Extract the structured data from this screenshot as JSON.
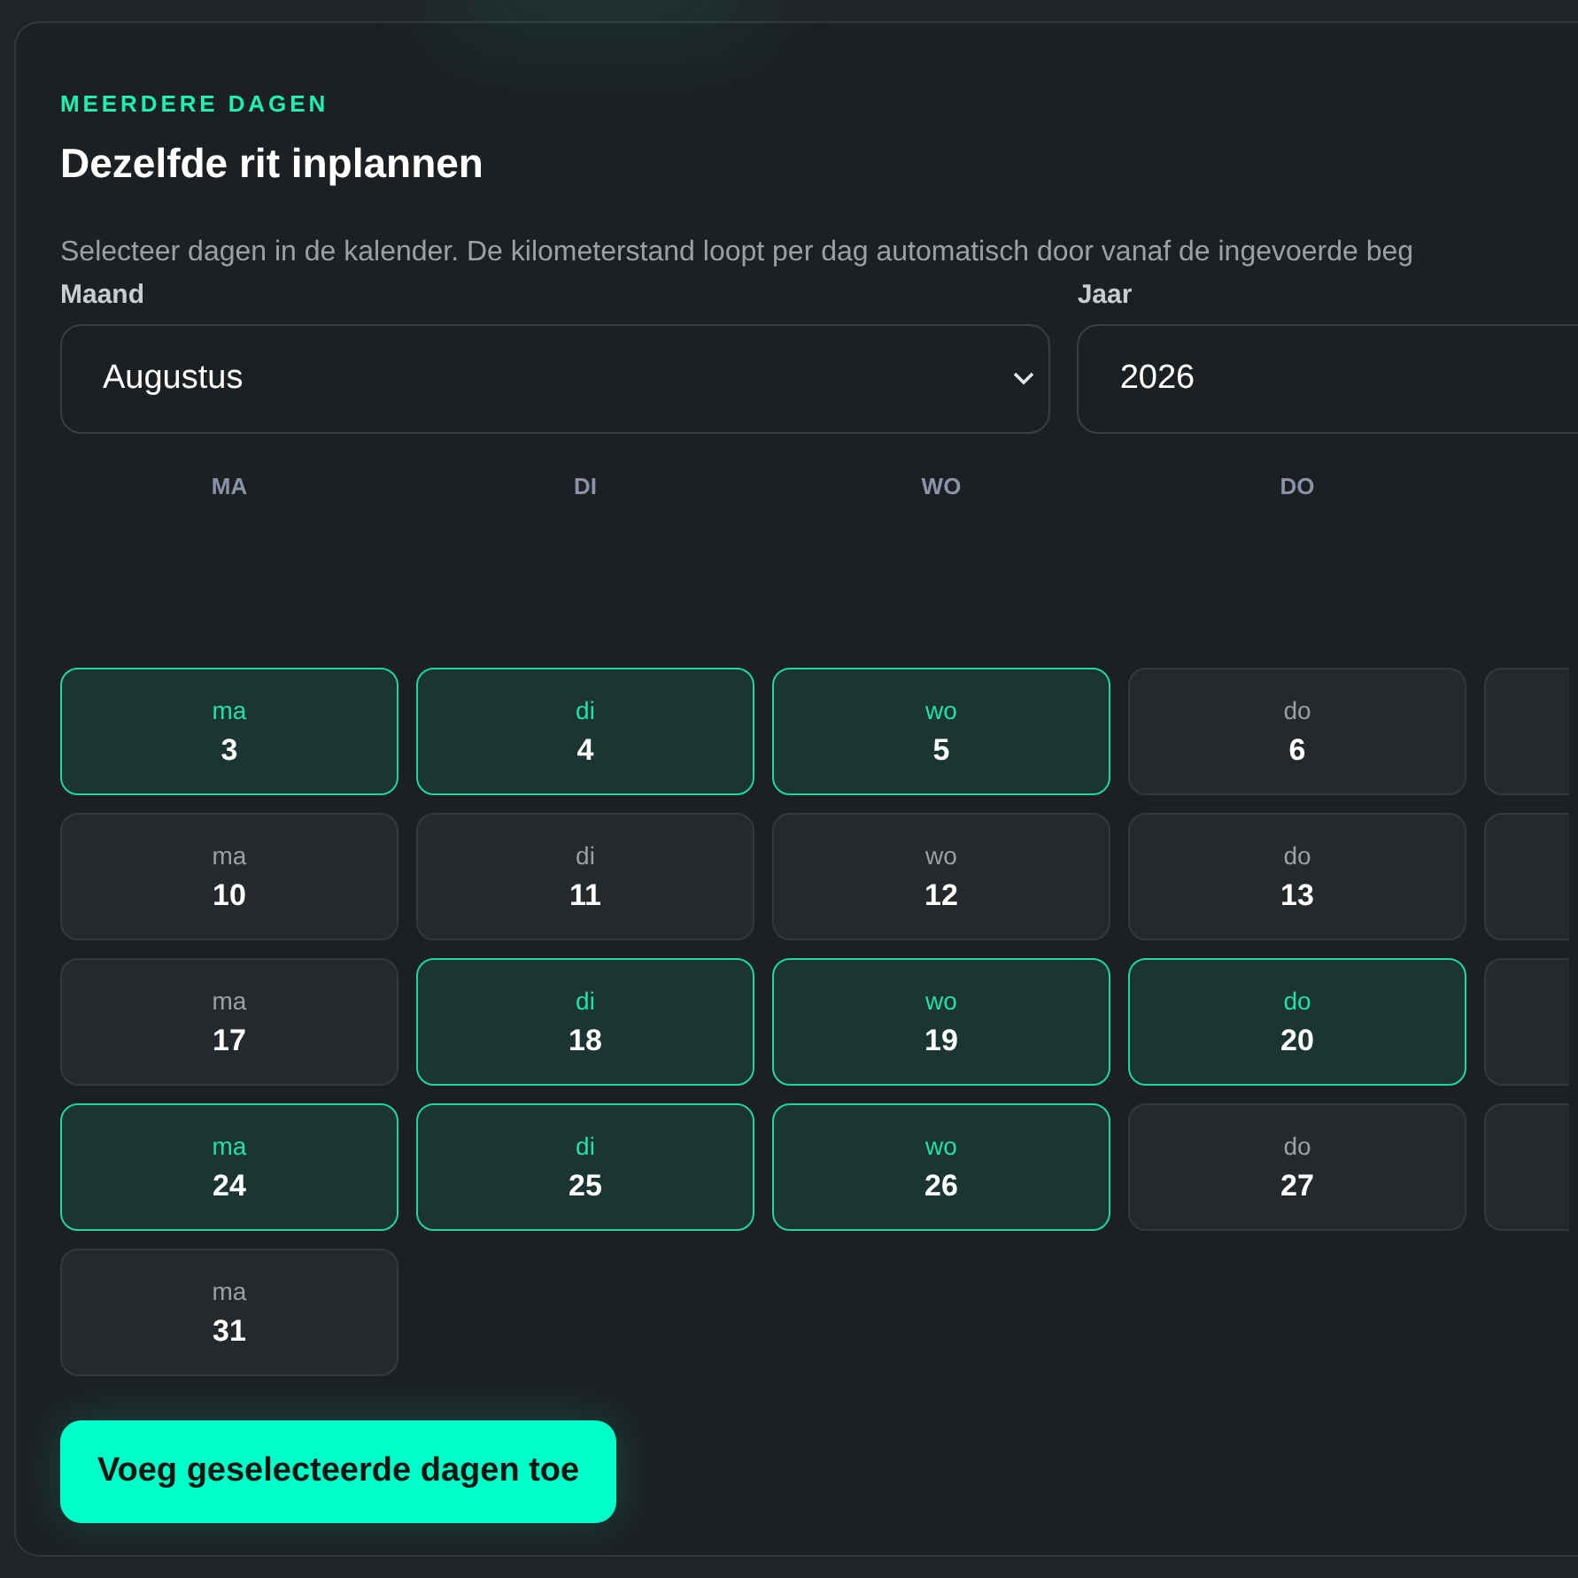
{
  "section_label": "MEERDERE DAGEN",
  "title": "Dezelfde rit inplannen",
  "description": "Selecteer dagen in de kalender. De kilometerstand loopt per dag automatisch door vanaf de ingevoerde beg",
  "month": {
    "label": "Maand",
    "value": "Augustus"
  },
  "year": {
    "label": "Jaar",
    "value": "2026"
  },
  "weekday_headers": [
    "MA",
    "DI",
    "WO",
    "DO"
  ],
  "weeks": [
    [
      {
        "kind": "blank"
      },
      {
        "kind": "blank"
      },
      {
        "kind": "blank"
      },
      {
        "kind": "blank"
      },
      {
        "kind": "blank"
      }
    ],
    [
      {
        "kind": "day",
        "weekday": "ma",
        "day": "3",
        "selected": true
      },
      {
        "kind": "day",
        "weekday": "di",
        "day": "4",
        "selected": true
      },
      {
        "kind": "day",
        "weekday": "wo",
        "day": "5",
        "selected": true
      },
      {
        "kind": "day",
        "weekday": "do",
        "day": "6",
        "selected": false
      },
      {
        "kind": "clipped",
        "selected": false
      }
    ],
    [
      {
        "kind": "day",
        "weekday": "ma",
        "day": "10",
        "selected": false
      },
      {
        "kind": "day",
        "weekday": "di",
        "day": "11",
        "selected": false
      },
      {
        "kind": "day",
        "weekday": "wo",
        "day": "12",
        "selected": false
      },
      {
        "kind": "day",
        "weekday": "do",
        "day": "13",
        "selected": false
      },
      {
        "kind": "clipped",
        "selected": false
      }
    ],
    [
      {
        "kind": "day",
        "weekday": "ma",
        "day": "17",
        "selected": false
      },
      {
        "kind": "day",
        "weekday": "di",
        "day": "18",
        "selected": true
      },
      {
        "kind": "day",
        "weekday": "wo",
        "day": "19",
        "selected": true
      },
      {
        "kind": "day",
        "weekday": "do",
        "day": "20",
        "selected": true
      },
      {
        "kind": "clipped",
        "selected": false
      }
    ],
    [
      {
        "kind": "day",
        "weekday": "ma",
        "day": "24",
        "selected": true
      },
      {
        "kind": "day",
        "weekday": "di",
        "day": "25",
        "selected": true
      },
      {
        "kind": "day",
        "weekday": "wo",
        "day": "26",
        "selected": true
      },
      {
        "kind": "day",
        "weekday": "do",
        "day": "27",
        "selected": false
      },
      {
        "kind": "clipped",
        "selected": false
      }
    ],
    [
      {
        "kind": "day",
        "weekday": "ma",
        "day": "31",
        "selected": false
      }
    ]
  ],
  "add_button": "Voeg geselecteerde dagen toe"
}
